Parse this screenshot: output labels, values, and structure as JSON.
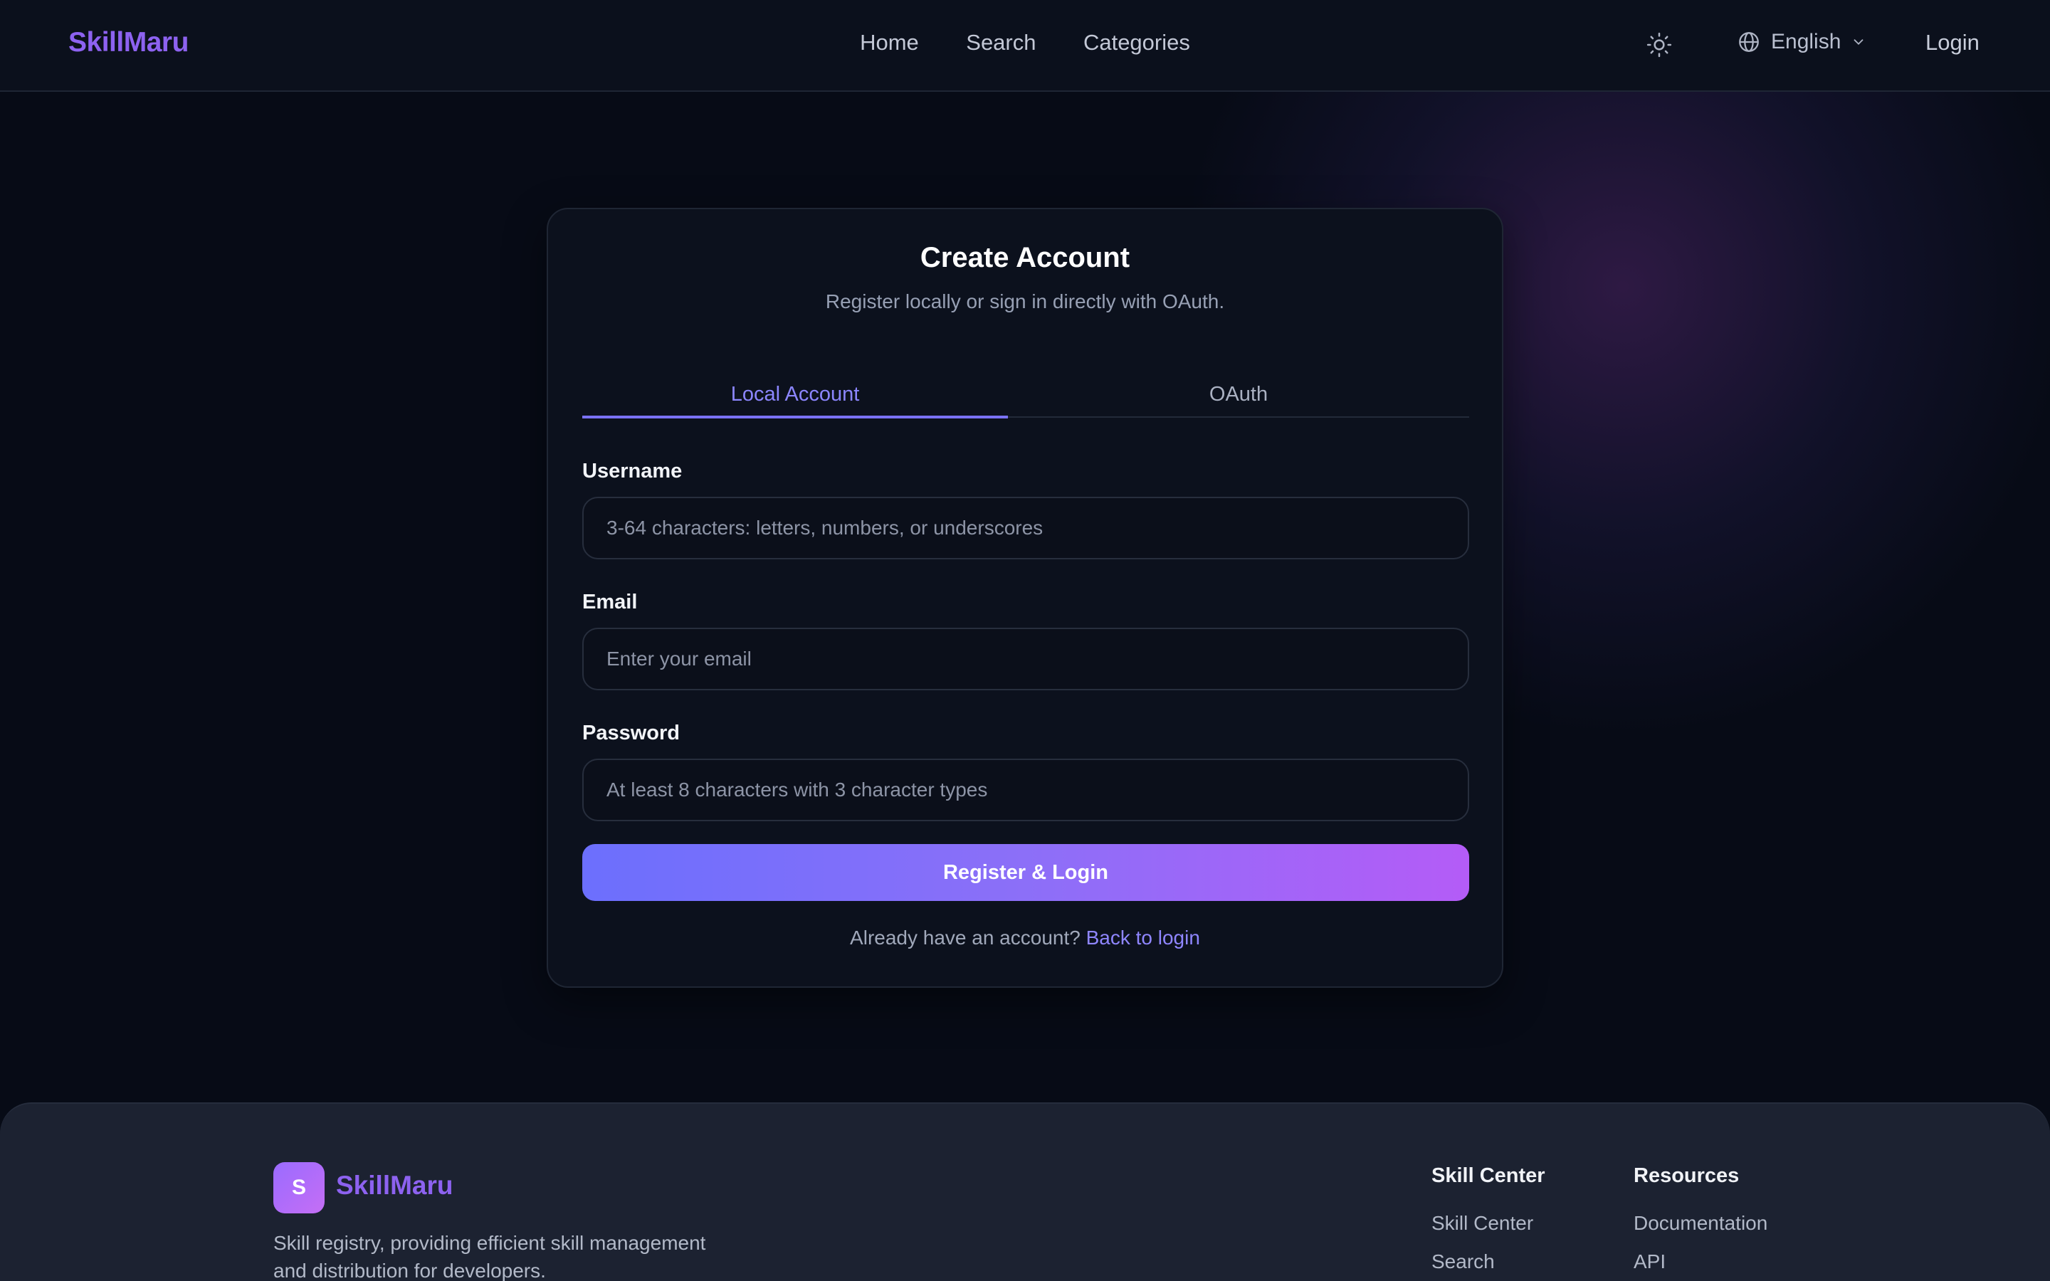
{
  "header": {
    "brand": "SkillMaru",
    "nav": [
      "Home",
      "Search",
      "Categories"
    ],
    "theme_icon": "sun-icon",
    "language": "English",
    "login": "Login"
  },
  "card": {
    "title": "Create Account",
    "subtitle": "Register locally or sign in directly with OAuth.",
    "tabs": [
      {
        "label": "Local Account",
        "active": true
      },
      {
        "label": "OAuth",
        "active": false
      }
    ],
    "fields": {
      "username": {
        "label": "Username",
        "placeholder": "3-64 characters: letters, numbers, or underscores",
        "value": ""
      },
      "email": {
        "label": "Email",
        "placeholder": "Enter your email",
        "value": ""
      },
      "password": {
        "label": "Password",
        "placeholder": "At least 8 characters with 3 character types",
        "value": ""
      }
    },
    "submit": "Register & Login",
    "switch_text": "Already have an account?",
    "switch_link": "Back to login"
  },
  "footer": {
    "logo_letter": "S",
    "brand": "SkillMaru",
    "description": "Skill registry, providing efficient skill management and distribution for developers.",
    "columns": [
      {
        "title": "Skill Center",
        "links": [
          "Skill Center",
          "Search"
        ]
      },
      {
        "title": "Resources",
        "links": [
          "Documentation",
          "API"
        ]
      }
    ]
  },
  "colors": {
    "accent": "#8d62f0",
    "tab_active": "#8c86ff",
    "button_gradient_start": "#6c6ffd",
    "button_gradient_end": "#b45cf7",
    "background": "#070b16"
  }
}
